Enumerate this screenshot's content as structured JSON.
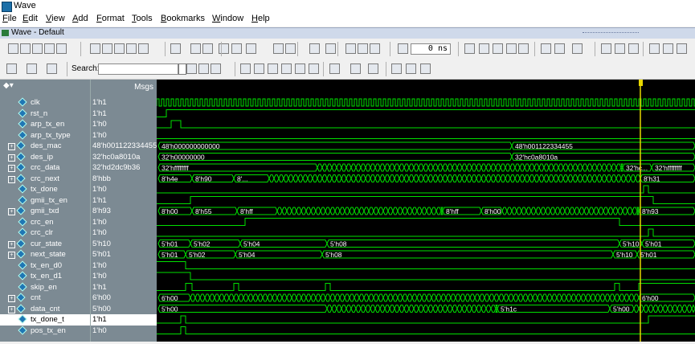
{
  "window": {
    "title": "Wave"
  },
  "menu": [
    {
      "label": "File",
      "u": "F",
      "rest": "ile"
    },
    {
      "label": "Edit",
      "u": "E",
      "rest": "dit"
    },
    {
      "label": "View",
      "u": "V",
      "rest": "iew"
    },
    {
      "label": "Add",
      "u": "A",
      "rest": "dd"
    },
    {
      "label": "Format",
      "u": "F",
      "rest": "ormat"
    },
    {
      "label": "Tools",
      "u": "T",
      "rest": "ools"
    },
    {
      "label": "Bookmarks",
      "u": "B",
      "rest": "ookmarks"
    },
    {
      "label": "Window",
      "u": "W",
      "rest": "indow"
    },
    {
      "label": "Help",
      "u": "H",
      "rest": "elp"
    }
  ],
  "panel": {
    "title": "Wave - Default"
  },
  "toolbar": {
    "time_value": "0 ns",
    "search_label": "Search:",
    "search_value": ""
  },
  "pane": {
    "msgs_header": "Msgs"
  },
  "colors": {
    "wave": "#00e000",
    "bg": "#000000",
    "cursor": "#e8d800",
    "selected": "#ffffff"
  },
  "signals": [
    {
      "name": "clk",
      "value": "1'h1",
      "bus": false
    },
    {
      "name": "rst_n",
      "value": "1'h1",
      "bus": false
    },
    {
      "name": "arp_tx_en",
      "value": "1'h0",
      "bus": false
    },
    {
      "name": "arp_tx_type",
      "value": "1'h0",
      "bus": false
    },
    {
      "name": "des_mac",
      "value": "48'h001122334455",
      "bus": true
    },
    {
      "name": "des_ip",
      "value": "32'hc0a8010a",
      "bus": true
    },
    {
      "name": "crc_data",
      "value": "32'hd2dc9b36",
      "bus": true
    },
    {
      "name": "crc_next",
      "value": "8'hbb",
      "bus": true
    },
    {
      "name": "tx_done",
      "value": "1'h0",
      "bus": false
    },
    {
      "name": "gmii_tx_en",
      "value": "1'h1",
      "bus": false
    },
    {
      "name": "gmii_txd",
      "value": "8'h93",
      "bus": true
    },
    {
      "name": "crc_en",
      "value": "1'h0",
      "bus": false
    },
    {
      "name": "crc_clr",
      "value": "1'h0",
      "bus": false
    },
    {
      "name": "cur_state",
      "value": "5'h10",
      "bus": true
    },
    {
      "name": "next_state",
      "value": "5'h01",
      "bus": true
    },
    {
      "name": "tx_en_d0",
      "value": "1'h0",
      "bus": false
    },
    {
      "name": "tx_en_d1",
      "value": "1'h0",
      "bus": false
    },
    {
      "name": "skip_en",
      "value": "1'h1",
      "bus": false
    },
    {
      "name": "cnt",
      "value": "6'h00",
      "bus": true
    },
    {
      "name": "data_cnt",
      "value": "5'h00",
      "bus": true
    },
    {
      "name": "tx_done_t",
      "value": "1'h1",
      "bus": false,
      "selected": true
    },
    {
      "name": "pos_tx_en",
      "value": "1'h0",
      "bus": false
    }
  ],
  "bus_labels": {
    "des_mac": [
      "48'h000000000000",
      "48'h001122334455"
    ],
    "des_ip": [
      "32'h00000000",
      "32'hc0a8010a"
    ],
    "crc_data": [
      "32'hffffffff",
      "32'hc...",
      "32'hffffffff"
    ],
    "crc_next": [
      "8'h4e",
      "8'h90",
      "8'...",
      "8'h31"
    ],
    "gmii_txd": [
      "8'h00",
      "8'h55",
      "8'hff",
      "8'hff",
      "8'h00",
      "8'h93"
    ],
    "cur_state": [
      "5'h01",
      "5'h02",
      "5'h04",
      "5'h08",
      "5'h10",
      "5'h01"
    ],
    "next_state": [
      "5'h01",
      "5'h02",
      "5'h04",
      "5'h08",
      "5'h10",
      "5'h01"
    ],
    "cnt": [
      "6'h00",
      "6'h00"
    ],
    "data_cnt": [
      "5'h00",
      "5'h1c",
      "5'h00"
    ]
  }
}
